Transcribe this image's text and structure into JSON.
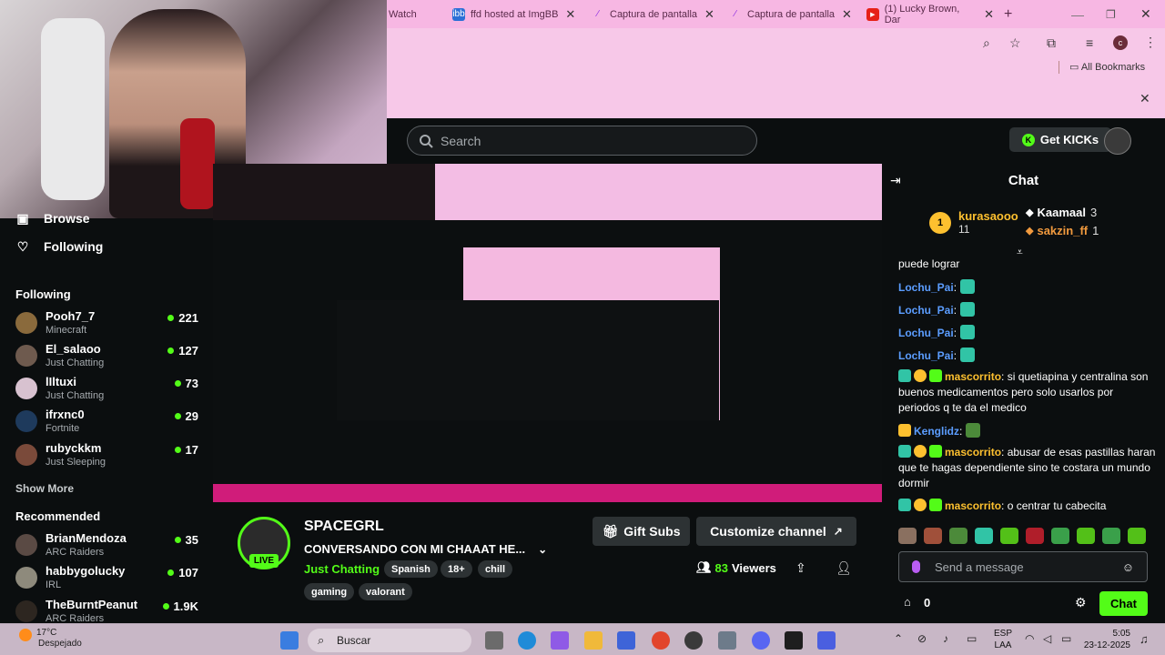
{
  "browser": {
    "tabs": [
      {
        "label": "Watch"
      },
      {
        "label": "ffd hosted at ImgBB"
      },
      {
        "label": "Captura de pantalla"
      },
      {
        "label": "Captura de pantalla"
      },
      {
        "label": "(1) Lucky Brown, Dar"
      }
    ],
    "bookmarks_label": "All Bookmarks"
  },
  "header": {
    "search_placeholder": "Search",
    "get_kicks_label": "Get KICKs"
  },
  "sidebar": {
    "nav": [
      {
        "label": "Browse"
      },
      {
        "label": "Following"
      }
    ],
    "following_title": "Following",
    "following": [
      {
        "name": "Pooh7_7",
        "category": "Minecraft",
        "viewers": "221",
        "color": "#8a6a3c"
      },
      {
        "name": "El_salaoo",
        "category": "Just Chatting",
        "viewers": "127",
        "color": "#6e5a4e"
      },
      {
        "name": "lIltuxi",
        "category": "Just Chatting",
        "viewers": "73",
        "color": "#d8c2d0"
      },
      {
        "name": "ifrxnc0",
        "category": "Fortnite",
        "viewers": "29",
        "color": "#1e3a5c"
      },
      {
        "name": "rubyckkm",
        "category": "Just Sleeping",
        "viewers": "17",
        "color": "#7a4a3a"
      }
    ],
    "show_more": "Show More",
    "recommended_title": "Recommended",
    "recommended": [
      {
        "name": "BrianMendoza",
        "category": "ARC Raiders",
        "viewers": "35",
        "color": "#5a4a44"
      },
      {
        "name": "habbygolucky",
        "category": "IRL",
        "viewers": "107",
        "color": "#8e8a7c"
      },
      {
        "name": "TheBurntPeanut",
        "category": "ARC Raiders",
        "viewers": "1.9K",
        "color": "#2d2620"
      }
    ]
  },
  "stream": {
    "channel": "SPACEGRL",
    "title": "CONVERSANDO CON MI CHAAAT HE...",
    "category": "Just Chatting",
    "tags": [
      "Spanish",
      "18+",
      "chill",
      "gaming",
      "valorant"
    ],
    "live_label": "LIVE",
    "gift_subs_label": "Gift Subs",
    "customize_label": "Customize channel",
    "viewers_count": "83",
    "viewers_label": "Viewers"
  },
  "chat": {
    "title": "Chat",
    "top_gifters": [
      {
        "name": "kurasaooo",
        "count": "11"
      },
      {
        "name": "Kaamaal",
        "count": "3"
      },
      {
        "name": "sakzin_ff",
        "count": "1"
      }
    ],
    "messages": [
      {
        "user": "",
        "text": "puede lograr",
        "color": "#ffffff"
      },
      {
        "user": "Lochu_Pai",
        "text": ":",
        "color": "#5b9dff"
      },
      {
        "user": "Lochu_Pai",
        "text": ":",
        "color": "#5b9dff"
      },
      {
        "user": "Lochu_Pai",
        "text": ":",
        "color": "#5b9dff"
      },
      {
        "user": "Lochu_Pai",
        "text": ":",
        "color": "#5b9dff"
      },
      {
        "user": "mascorrito",
        "text": ": si quetiapina y centralina son buenos medicamentos pero solo usarlos por periodos q te da el medico",
        "color": "#fdc02f"
      },
      {
        "user": "Kenglidz",
        "text": ":",
        "color": "#5b9dff"
      },
      {
        "user": "mascorrito",
        "text": ": abusar de esas pastillas haran que te hagas dependiente sino te costara un mundo dormir",
        "color": "#fdc02f"
      },
      {
        "user": "mascorrito",
        "text": ": o centrar tu cabecita",
        "color": "#fdc02f"
      }
    ],
    "send_placeholder": "Send a message",
    "kicks_count": "0",
    "chat_button": "Chat"
  },
  "taskbar": {
    "temp": "17°C",
    "weather": "Despejado",
    "search_label": "Buscar",
    "lang_top": "ESP",
    "lang_bottom": "LAA",
    "time": "5:05",
    "date": "23-12-2025"
  },
  "colors": {
    "accent": "#53fc18",
    "chrome_pink": "#f7c8e8",
    "bg": "#0b0e0f"
  }
}
